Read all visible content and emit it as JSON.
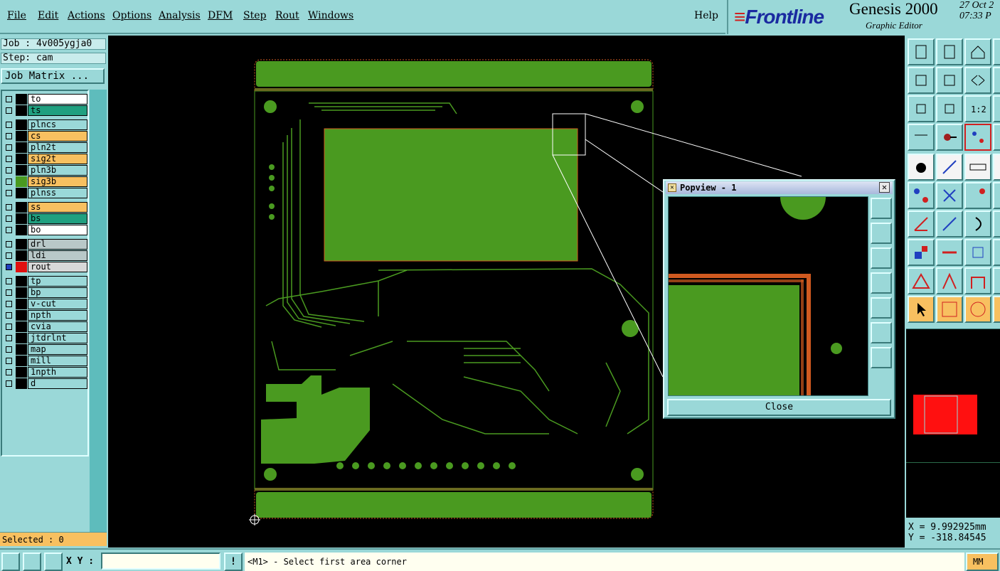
{
  "menu": [
    "File",
    "Edit",
    "Actions",
    "Options",
    "Analysis",
    "DFM",
    "Step",
    "Rout",
    "Windows"
  ],
  "help": "Help",
  "brand": {
    "logo": "Frontline",
    "title": "Genesis 2000",
    "subtitle": "Graphic Editor",
    "date": "27 Oct 2",
    "time": "07:33 P"
  },
  "job": "Job : 4v005ygja0",
  "step": "Step: cam",
  "job_matrix": "Job Matrix ...",
  "layers": [
    {
      "name": "to",
      "bg": "#ffffff",
      "swatch": "#000000"
    },
    {
      "name": "ts",
      "bg": "#20a080",
      "swatch": "#000000"
    },
    {
      "name": "plncs",
      "bg": "#9ad8d8",
      "swatch": "#000000"
    },
    {
      "name": "cs",
      "bg": "#f8c060",
      "swatch": "#000000"
    },
    {
      "name": "pln2t",
      "bg": "#9ad8d8",
      "swatch": "#000000"
    },
    {
      "name": "sig2t",
      "bg": "#f8c060",
      "swatch": "#000000"
    },
    {
      "name": "pln3b",
      "bg": "#9ad8d8",
      "swatch": "#000000"
    },
    {
      "name": "sig3b",
      "bg": "#f8c060",
      "swatch": "#4a9a20"
    },
    {
      "name": "plnss",
      "bg": "#9ad8d8",
      "swatch": "#000000"
    },
    {
      "name": "ss",
      "bg": "#f8c060",
      "swatch": "#000000"
    },
    {
      "name": "bs",
      "bg": "#20a080",
      "swatch": "#000000"
    },
    {
      "name": "bo",
      "bg": "#ffffff",
      "swatch": "#000000"
    },
    {
      "name": "drl",
      "bg": "#b8c8c8",
      "swatch": "#000000"
    },
    {
      "name": "ldi",
      "bg": "#b8c8c8",
      "swatch": "#000000"
    },
    {
      "name": "rout",
      "bg": "#d8d8d8",
      "swatch": "#e01010"
    },
    {
      "name": "tp",
      "bg": "#9ad8d8",
      "swatch": "#000000"
    },
    {
      "name": "bp",
      "bg": "#9ad8d8",
      "swatch": "#000000"
    },
    {
      "name": "v-cut",
      "bg": "#9ad8d8",
      "swatch": "#000000"
    },
    {
      "name": "npth",
      "bg": "#9ad8d8",
      "swatch": "#000000"
    },
    {
      "name": "cvia",
      "bg": "#9ad8d8",
      "swatch": "#000000"
    },
    {
      "name": "jtdrlnt",
      "bg": "#9ad8d8",
      "swatch": "#000000"
    },
    {
      "name": "map",
      "bg": "#9ad8d8",
      "swatch": "#000000"
    },
    {
      "name": "mill",
      "bg": "#9ad8d8",
      "swatch": "#000000"
    },
    {
      "name": "1npth",
      "bg": "#9ad8d8",
      "swatch": "#000000"
    },
    {
      "name": "d",
      "bg": "#9ad8d8",
      "swatch": "#000000"
    }
  ],
  "selected": "Selected : 0",
  "popview": {
    "title": "Popview - 1",
    "close": "Close"
  },
  "status": {
    "xy_label": "X Y :",
    "xy_value": "",
    "prompt": "<M1> - Select first area corner",
    "units": "MM"
  },
  "coords": {
    "x": "X = 9.992925mm",
    "y": "Y = -318.84545"
  },
  "colors": {
    "panel": "#9ad8d8",
    "copper": "#4a9a20",
    "accent": "#f8c060",
    "outline": "#d05a20"
  }
}
